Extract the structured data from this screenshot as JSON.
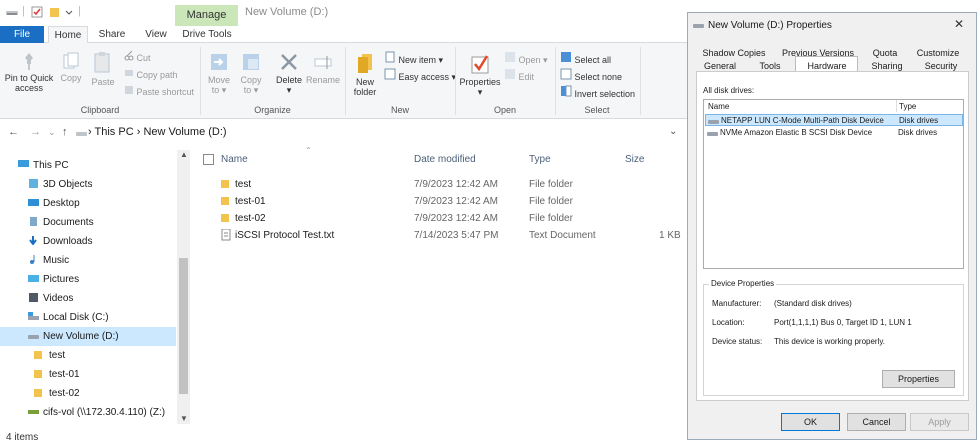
{
  "window": {
    "title": "New Volume (D:)",
    "manage_tab": "Manage"
  },
  "ribbon_tabs": [
    "File",
    "Home",
    "Share",
    "View",
    "Drive Tools"
  ],
  "ribbon": {
    "clipboard": {
      "pin": "Pin to Quick access",
      "copy": "Copy",
      "paste": "Paste",
      "cut": "Cut",
      "copy_path": "Copy path",
      "paste_shortcut": "Paste shortcut",
      "group": "Clipboard"
    },
    "organize": {
      "move_to": "Move to",
      "copy_to": "Copy to",
      "delete": "Delete",
      "rename": "Rename",
      "group": "Organize"
    },
    "new": {
      "new_folder": "New folder",
      "new_item": "New item",
      "easy_access": "Easy access",
      "group": "New"
    },
    "open": {
      "properties": "Properties",
      "open": "Open",
      "edit": "Edit",
      "group": "Open"
    },
    "select": {
      "select_all": "Select all",
      "select_none": "Select none",
      "invert_selection": "Invert selection",
      "group": "Select"
    }
  },
  "address": {
    "crumb1": "This PC",
    "crumb2": "New Volume (D:)"
  },
  "nav": {
    "this_pc": "This PC",
    "items": [
      "3D Objects",
      "Desktop",
      "Documents",
      "Downloads",
      "Music",
      "Pictures",
      "Videos",
      "Local Disk (C:)",
      "New Volume (D:)",
      "test",
      "test-01",
      "test-02",
      "cifs-vol (\\\\172.30.4.110) (Z:)"
    ]
  },
  "file_list": {
    "headers": {
      "name": "Name",
      "date": "Date modified",
      "type": "Type",
      "size": "Size"
    },
    "rows": [
      {
        "name": "test",
        "date": "7/9/2023 12:42 AM",
        "type": "File folder",
        "size": ""
      },
      {
        "name": "test-01",
        "date": "7/9/2023 12:42 AM",
        "type": "File folder",
        "size": ""
      },
      {
        "name": "test-02",
        "date": "7/9/2023 12:42 AM",
        "type": "File folder",
        "size": ""
      },
      {
        "name": "iSCSI Protocol Test.txt",
        "date": "7/14/2023 5:47 PM",
        "type": "Text Document",
        "size": "1 KB"
      }
    ]
  },
  "status": "4 items",
  "dialog": {
    "title": "New Volume (D:) Properties",
    "tabs_row1": [
      "Shadow Copies",
      "Previous Versions",
      "Quota",
      "Customize"
    ],
    "tabs_row2": [
      "General",
      "Tools",
      "Hardware",
      "Sharing",
      "Security"
    ],
    "all_disk_drives": "All disk drives:",
    "col_name": "Name",
    "col_type": "Type",
    "drives": [
      {
        "name": "NETAPP LUN C-Mode  Multi-Path Disk Device",
        "type": "Disk drives"
      },
      {
        "name": "NVMe Amazon Elastic B SCSI Disk Device",
        "type": "Disk drives"
      }
    ],
    "device_properties": "Device Properties",
    "manufacturer_label": "Manufacturer:",
    "manufacturer_value": "(Standard disk drives)",
    "location_label": "Location:",
    "location_value": "Port(1,1,1,1) Bus 0, Target ID 1, LUN 1",
    "status_label": "Device status:",
    "status_value": "This device is working properly.",
    "properties_button": "Properties",
    "ok": "OK",
    "cancel": "Cancel",
    "apply": "Apply"
  },
  "colors": {
    "file_tab": "#1a6fc4",
    "manage_tab": "#cbe6b8",
    "selection": "#cce8ff",
    "folder": "#f2c44d"
  }
}
